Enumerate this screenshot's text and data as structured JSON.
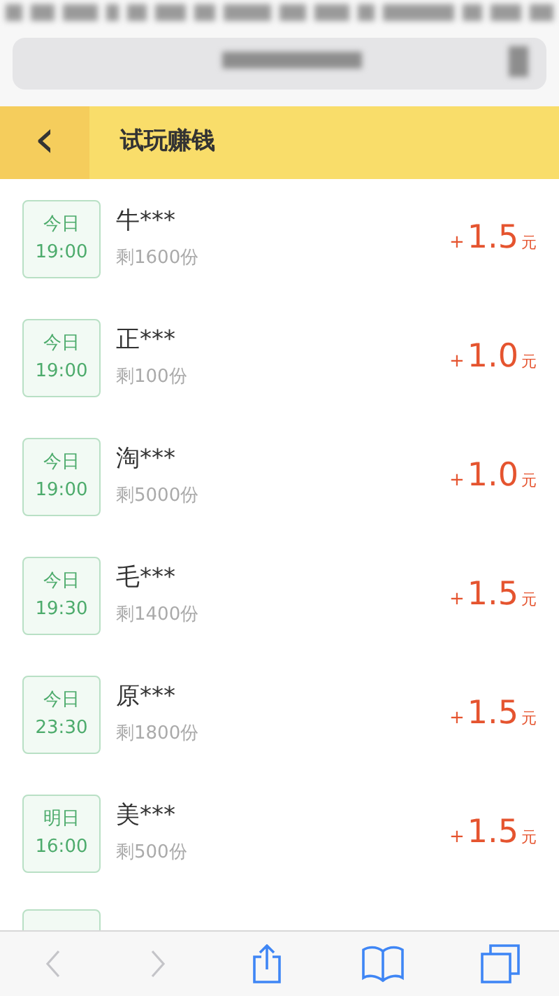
{
  "browser": {
    "address_blurred": true
  },
  "header": {
    "back_label": "‹",
    "title": "试玩赚钱"
  },
  "tasks": [
    {
      "day": "今日",
      "time": "19:00",
      "name": "牛***",
      "remaining": "剩1600份",
      "sign": "+",
      "amount": "1.5",
      "unit": "元"
    },
    {
      "day": "今日",
      "time": "19:00",
      "name": "正***",
      "remaining": "剩100份",
      "sign": "+",
      "amount": "1.0",
      "unit": "元"
    },
    {
      "day": "今日",
      "time": "19:00",
      "name": "淘***",
      "remaining": "剩5000份",
      "sign": "+",
      "amount": "1.0",
      "unit": "元"
    },
    {
      "day": "今日",
      "time": "19:30",
      "name": "毛***",
      "remaining": "剩1400份",
      "sign": "+",
      "amount": "1.5",
      "unit": "元"
    },
    {
      "day": "今日",
      "time": "23:30",
      "name": "原***",
      "remaining": "剩1800份",
      "sign": "+",
      "amount": "1.5",
      "unit": "元"
    },
    {
      "day": "明日",
      "time": "16:00",
      "name": "美***",
      "remaining": "剩500份",
      "sign": "+",
      "amount": "1.5",
      "unit": "元"
    }
  ],
  "more_below": true,
  "toolbar": [
    {
      "kind": "back",
      "disabled": true
    },
    {
      "kind": "forward",
      "disabled": true
    },
    {
      "kind": "share",
      "disabled": false
    },
    {
      "kind": "bookmarks",
      "disabled": false
    },
    {
      "kind": "tabs",
      "disabled": false
    }
  ]
}
